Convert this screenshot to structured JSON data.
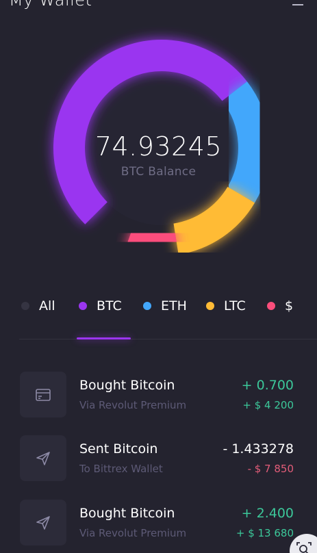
{
  "header": {
    "title": "My Wallet",
    "menu_icon": "menu-icon"
  },
  "balance": {
    "value": "74.93245",
    "label": "BTC Balance"
  },
  "donut": {
    "segments": [
      {
        "name": "BTC",
        "fraction": 0.52,
        "color": "#9a36f0"
      },
      {
        "name": "ETH",
        "fraction": 0.19,
        "color": "#43a7fb"
      },
      {
        "name": "LTC",
        "fraction": 0.14,
        "color": "#ffbb36"
      },
      {
        "name": "$",
        "fraction": 0.08,
        "color": "#fb4e7c"
      }
    ]
  },
  "tabs": [
    {
      "label": "All",
      "color": "#353442",
      "active": false
    },
    {
      "label": "BTC",
      "color": "#9a36f0",
      "active": true
    },
    {
      "label": "ETH",
      "color": "#43a7fb",
      "active": false
    },
    {
      "label": "LTC",
      "color": "#ffbb36",
      "active": false
    },
    {
      "label": "$",
      "color": "#fb4e7c",
      "active": false
    }
  ],
  "transactions": [
    {
      "icon": "card-icon",
      "title": "Bought Bitcoin",
      "subtitle": "Via Revolut Premium",
      "amount": "+ 0.700",
      "fiat": "+ $ 4 200",
      "direction": "pos"
    },
    {
      "icon": "send-icon",
      "title": "Sent Bitcoin",
      "subtitle": "To Bittrex Wallet",
      "amount": "- 1.433278",
      "fiat": "- $ 7 850",
      "direction": "neg"
    },
    {
      "icon": "send-icon",
      "title": "Bought Bitcoin",
      "subtitle": "Via Revolut Premium",
      "amount": "+ 2.400",
      "fiat": "+ $ 13 680",
      "direction": "pos"
    }
  ],
  "fab": {
    "icon": "scan-search-icon"
  }
}
